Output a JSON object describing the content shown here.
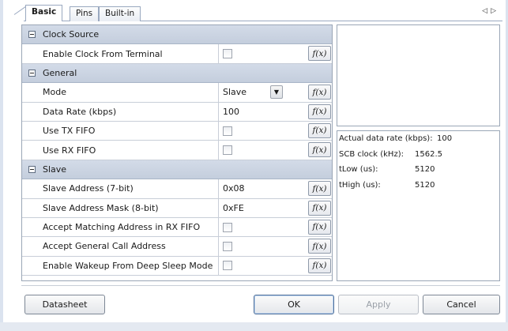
{
  "tabs": [
    {
      "label": "Basic",
      "active": true
    },
    {
      "label": "Pins",
      "active": false
    },
    {
      "label": "Built-in",
      "active": false
    }
  ],
  "tab_nav": {
    "prev": "◁",
    "next": "▷"
  },
  "fx_label": "f(x)",
  "groups": {
    "clock_source": {
      "label": "Clock Source",
      "rows": {
        "enable_clock": {
          "name": "Enable Clock From Terminal",
          "checked": false
        }
      }
    },
    "general": {
      "label": "General",
      "rows": {
        "mode": {
          "name": "Mode",
          "value": "Slave",
          "dropdown_icon": "dropdown-arrow-icon"
        },
        "data_rate": {
          "name": "Data Rate (kbps)",
          "value": "100"
        },
        "use_tx_fifo": {
          "name": "Use TX FIFO",
          "checked": false
        },
        "use_rx_fifo": {
          "name": "Use RX FIFO",
          "checked": false
        }
      }
    },
    "slave": {
      "label": "Slave",
      "rows": {
        "slave_address": {
          "name": "Slave Address (7-bit)",
          "value": "0x08"
        },
        "slave_address_mask": {
          "name": "Slave Address Mask (8-bit)",
          "value": "0xFE"
        },
        "accept_matching": {
          "name": "Accept Matching Address in RX FIFO",
          "checked": false
        },
        "accept_general_call": {
          "name": "Accept General Call Address",
          "checked": false
        },
        "enable_wakeup": {
          "name": "Enable Wakeup From Deep Sleep Mode",
          "checked": false
        }
      }
    }
  },
  "info": {
    "actual_data_rate": {
      "label": "Actual data rate (kbps):",
      "value": "100"
    },
    "scb_clock": {
      "label": "SCB clock (kHz):",
      "value": "1562.5"
    },
    "tlow": {
      "label": "tLow (us):",
      "value": "5120"
    },
    "thigh": {
      "label": "tHigh (us):",
      "value": "5120"
    }
  },
  "buttons": {
    "datasheet": "Datasheet",
    "ok": "OK",
    "apply": "Apply",
    "cancel": "Cancel"
  },
  "colors": {
    "category_bg": "#c4cedd",
    "border": "#9aa6b6"
  }
}
